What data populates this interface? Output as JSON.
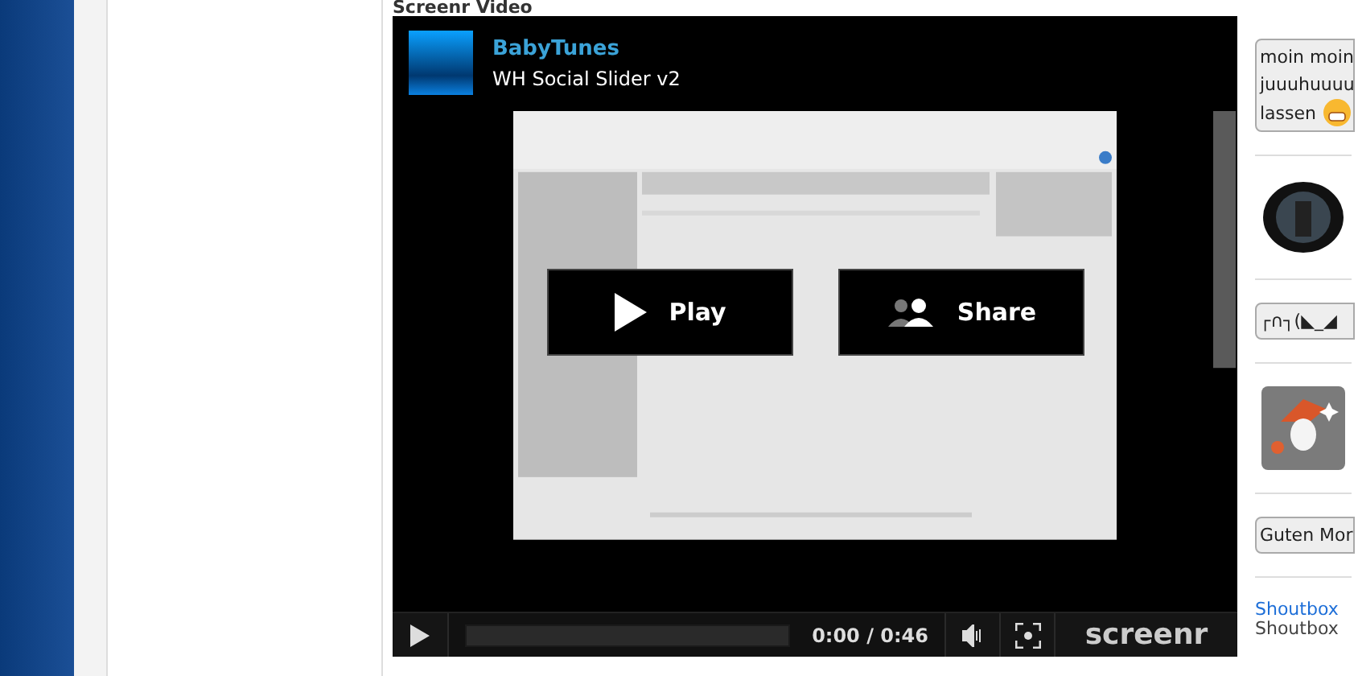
{
  "section_title": "Screenr Video",
  "video": {
    "channel": "BabyTunes",
    "title": "WH Social Slider v2",
    "overlay_buttons": [
      {
        "kind": "play",
        "label": "Play"
      },
      {
        "kind": "share",
        "label": "Share"
      }
    ],
    "controls": {
      "time": "0:00 / 0:46",
      "brand": "screenr"
    }
  },
  "shoutbox": {
    "messages": [
      {
        "kind": "bubble",
        "lines": [
          "moin moin",
          "juuuhuuuu",
          "lassen"
        ],
        "emoji": true
      },
      {
        "kind": "avatar"
      },
      {
        "kind": "bubble",
        "lines": [
          "┌∩┐(◣_◢"
        ],
        "emoji": false
      },
      {
        "kind": "badge"
      },
      {
        "kind": "bubble",
        "lines": [
          "Guten Mor"
        ],
        "emoji": false
      }
    ],
    "links": [
      "Shoutbox",
      "Shoutbox"
    ]
  }
}
